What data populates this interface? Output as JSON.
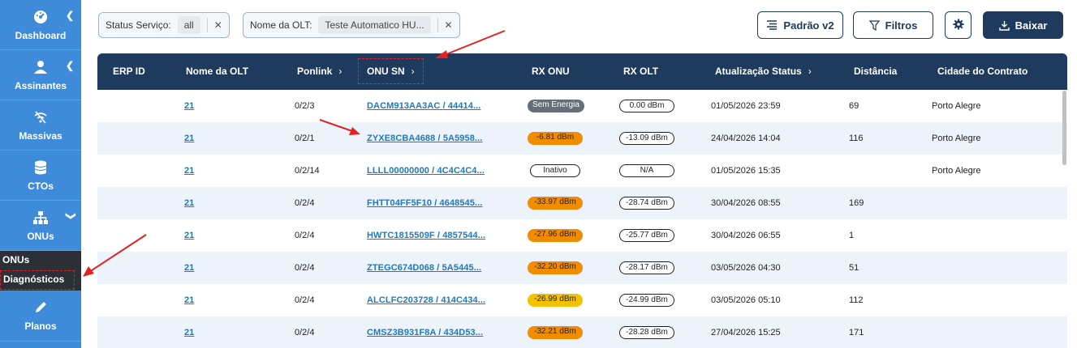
{
  "sidebar": {
    "items": [
      {
        "label": "Dashboard",
        "icon": "dashboard-icon"
      },
      {
        "label": "Assinantes",
        "icon": "user-icon"
      },
      {
        "label": "Massivas",
        "icon": "wifi-off-icon"
      },
      {
        "label": "CTOs",
        "icon": "database-icon"
      },
      {
        "label": "ONUs",
        "icon": "network-icon"
      },
      {
        "label": "Planos",
        "icon": "pencil-icon"
      }
    ],
    "submenu": [
      "ONUs",
      "Diagnósticos"
    ]
  },
  "filters": {
    "status_label": "Status Serviço:",
    "status_value": "all",
    "olt_label": "Nome da OLT:",
    "olt_value": "Teste Automatico HU..."
  },
  "toolbar": {
    "padrao_label": "Padrão v2",
    "filtros_label": "Filtros",
    "baixar_label": "Baixar"
  },
  "table": {
    "headers": [
      "ERP ID",
      "Nome da OLT",
      "Ponlink",
      "ONU SN",
      "RX ONU",
      "RX OLT",
      "Atualização Status",
      "Distância",
      "Cidade do Contrato"
    ],
    "rows": [
      {
        "olt": "21",
        "ponlink": "0/2/3",
        "sn": "DACM913AA3AC / 44414...",
        "rx_onu": "Sem Energia",
        "rx_olt": "0.00 dBm",
        "updated": "01/05/2026 23:59",
        "dist": "69",
        "city": "Porto Alegre"
      },
      {
        "olt": "21",
        "ponlink": "0/2/1",
        "sn": "ZYXE8CBA4688 / 5A5958...",
        "rx_onu": "-6.81 dBm",
        "rx_olt": "-13.09 dBm",
        "updated": "24/04/2026 14:04",
        "dist": "116",
        "city": "Porto Alegre"
      },
      {
        "olt": "21",
        "ponlink": "0/2/14",
        "sn": "LLLL00000000 / 4C4C4C4...",
        "rx_onu": "Inativo",
        "rx_olt": "N/A",
        "updated": "01/05/2026 15:35",
        "dist": "",
        "city": "Porto Alegre"
      },
      {
        "olt": "21",
        "ponlink": "0/2/4",
        "sn": "FHTT04FF5F10 / 4648545...",
        "rx_onu": "-33.97 dBm",
        "rx_olt": "-28.74 dBm",
        "updated": "30/04/2026 08:55",
        "dist": "169",
        "city": ""
      },
      {
        "olt": "21",
        "ponlink": "0/2/4",
        "sn": "HWTC1815509F / 4857544...",
        "rx_onu": "-27.96 dBm",
        "rx_olt": "-25.77 dBm",
        "updated": "30/04/2026 06:55",
        "dist": "1",
        "city": ""
      },
      {
        "olt": "21",
        "ponlink": "0/2/4",
        "sn": "ZTEGC674D068 / 5A5445...",
        "rx_onu": "-32.20 dBm",
        "rx_olt": "-28.17 dBm",
        "updated": "03/05/2026 04:30",
        "dist": "51",
        "city": ""
      },
      {
        "olt": "21",
        "ponlink": "0/2/4",
        "sn": "ALCLFC203728 / 414C434...",
        "rx_onu": "-26.99 dBm",
        "rx_olt": "-24.99 dBm",
        "updated": "03/05/2026 05:10",
        "dist": "112",
        "city": ""
      },
      {
        "olt": "21",
        "ponlink": "0/2/4",
        "sn": "CMSZ3B931F8A / 434D53...",
        "rx_onu": "-32.21 dBm",
        "rx_olt": "-28.28 dBm",
        "updated": "27/04/2026 15:25",
        "dist": "171",
        "city": ""
      }
    ]
  },
  "colors": {
    "sidebar": "#3d8bd9",
    "header": "#1e3a5c",
    "link": "#1a7abf",
    "orange": "#f08c00",
    "yellow": "#f2c200",
    "gray_badge": "#666e78",
    "annotation_red": "#e52222"
  }
}
